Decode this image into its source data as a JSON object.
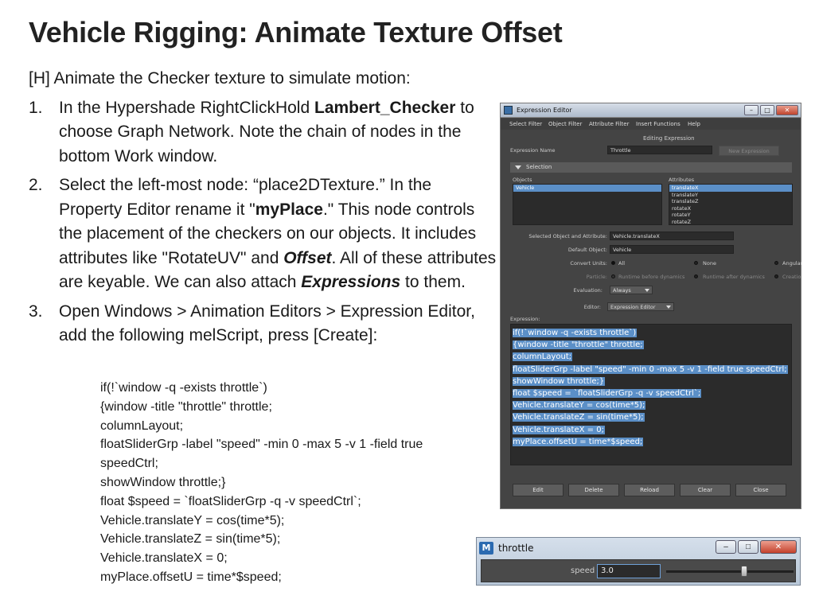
{
  "slide": {
    "title": "Vehicle Rigging: Animate Texture Offset",
    "intro": "[H] Animate the Checker texture to simulate motion:",
    "steps": [
      {
        "num": "1.",
        "t1": "In the Hypershade RightClickHold ",
        "b1": "Lambert_Checker",
        "t2": " to choose Graph Network. Note the chain of nodes in the bottom Work window."
      },
      {
        "num": "2.",
        "t1": "Select the left-most node: “place2DTexture.” In the Property Editor rename it \"",
        "b1": "myPlace",
        "t2": ".\" This node controls the placement of the checkers on our objects. It includes attributes like \"RotateUV\" and ",
        "bi1": "Offset",
        "t3": ". All of these attributes are keyable. We can also attach ",
        "bi2": "Expressions",
        "t4": " to them."
      },
      {
        "num": "3.",
        "t1": "Open Windows > Animation Editors > Expression Editor, add the following melScript, press [Create]:"
      }
    ],
    "code": [
      "if(!`window -q -exists throttle`)",
      "{window -title \"throttle\" throttle;",
      "columnLayout;",
      "floatSliderGrp -label \"speed\" -min 0 -max 5 -v 1 -field true",
      "speedCtrl;",
      "showWindow throttle;}",
      "float $speed = `floatSliderGrp -q -v speedCtrl`;",
      "Vehicle.translateY = cos(time*5);",
      "Vehicle.translateZ = sin(time*5);",
      "Vehicle.translateX = 0;",
      "myPlace.offsetU = time*$speed;"
    ]
  },
  "expression_editor": {
    "window_title": "Expression Editor",
    "window_buttons": {
      "minimize": "–",
      "maximize": "□",
      "close": "✕"
    },
    "menu": [
      "Select Filter",
      "Object Filter",
      "Attribute Filter",
      "Insert Functions",
      "Help"
    ],
    "editing_label": "Editing Expression",
    "expression_name_label": "Expression Name",
    "expression_name_value": "Throttle",
    "new_expression_button": "New Expression",
    "selection_section": "Selection",
    "objects_label": "Objects",
    "attributes_label": "Attributes",
    "objects": [
      "Vehicle"
    ],
    "attributes": [
      "translateX",
      "translateY",
      "translateZ",
      "rotateX",
      "rotateY",
      "rotateZ"
    ],
    "selected_attr_label": "Selected Object and Attribute:",
    "selected_attr_value": "Vehicle.translateX",
    "default_object_label": "Default Object:",
    "default_object_value": "Vehicle",
    "convert_units_label": "Convert Units:",
    "convert_units_options": [
      "All",
      "None",
      "Angular only"
    ],
    "particle_label": "Particle:",
    "particle_options": [
      "Runtime before dynamics",
      "Runtime after dynamics",
      "Creation"
    ],
    "evaluation_label": "Evaluation:",
    "evaluation_value": "Always",
    "editor_label": "Editor:",
    "editor_value": "Expression Editor",
    "expression_label": "Expression:",
    "expression_lines": [
      "if(!`window -q -exists throttle`)",
      "{window -title \"throttle\" throttle;",
      "columnLayout;",
      "floatSliderGrp -label \"speed\" -min 0 -max 5 -v 1 -field true speedCtrl;",
      "showWindow throttle;}",
      "float $speed = `floatSliderGrp -q -v speedCtrl`;",
      "Vehicle.translateY = cos(time*5);",
      "Vehicle.translateZ = sin(time*5);",
      "Vehicle.translateX = 0;",
      "myPlace.offsetU = time*$speed;"
    ],
    "bottom_buttons": [
      "Edit",
      "Delete",
      "Reload",
      "Clear",
      "Close"
    ]
  },
  "throttle_window": {
    "logo": "M",
    "title": "throttle",
    "window_buttons": {
      "minimize": "–",
      "maximize": "□",
      "close": "✕"
    },
    "speed_label": "speed",
    "speed_value": "3.0",
    "slider_min": 0,
    "slider_max": 5,
    "slider_value": 3.0
  }
}
